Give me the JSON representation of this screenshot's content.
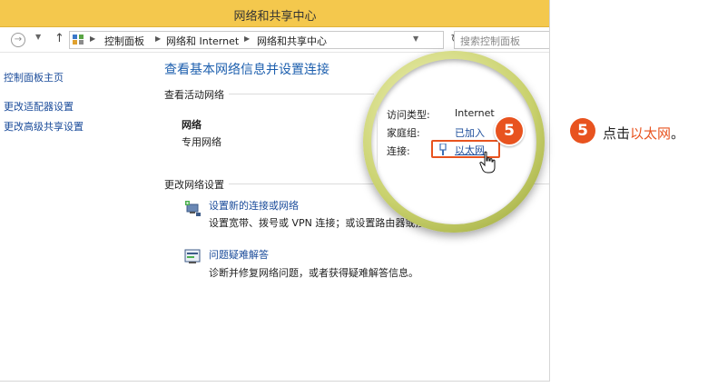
{
  "window": {
    "title": "网络和共享中心"
  },
  "navbar": {
    "breadcrumbs": [
      "控制面板",
      "网络和 Internet",
      "网络和共享中心"
    ],
    "search_placeholder": "搜索控制面板"
  },
  "left_pane": {
    "items": [
      "控制面板主页",
      "更改适配器设置",
      "更改高级共享设置"
    ]
  },
  "main": {
    "heading": "查看基本网络信息并设置连接",
    "active_networks_label": "查看活动网络",
    "network": {
      "name": "网络",
      "type": "专用网络"
    },
    "details": {
      "access_type_label": "访问类型:",
      "access_type_value": "Internet",
      "homegroup_label": "家庭组:",
      "homegroup_value": "已加入",
      "connection_label": "连接:",
      "connection_value": "以太网"
    },
    "change_settings_label": "更改网络设置",
    "tasks": [
      {
        "link": "设置新的连接或网络",
        "desc": "设置宽带、拨号或 VPN 连接；或设置路由器或接入点。"
      },
      {
        "link": "问题疑难解答",
        "desc": "诊断并修复网络问题，或者获得疑难解答信息。"
      }
    ]
  },
  "step": {
    "number": "5",
    "text_prefix": "点击",
    "text_highlight": "以太网",
    "text_suffix": "。"
  },
  "colors": {
    "titlebar": "#f4c84d",
    "accent_orange": "#e8531f",
    "link_blue": "#1a4b9a"
  }
}
